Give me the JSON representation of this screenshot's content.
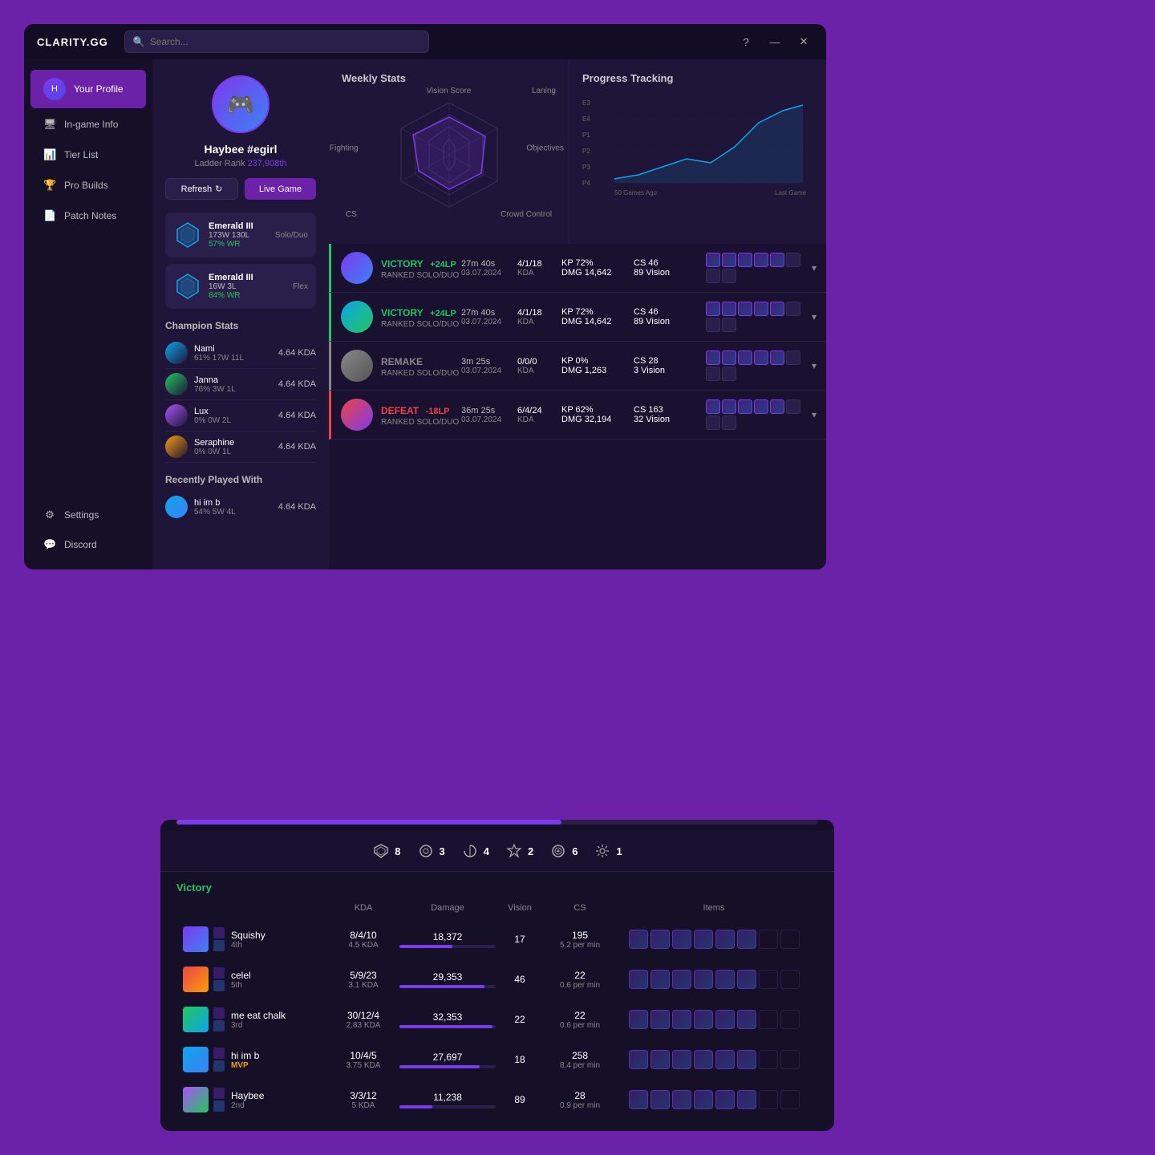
{
  "app": {
    "logo": "CLARITY.GG",
    "search_placeholder": "Search...",
    "search_label": "Search",
    "window_controls": {
      "help": "?",
      "minimize": "—",
      "close": "✕"
    }
  },
  "sidebar": {
    "items": [
      {
        "id": "profile",
        "label": "Your Profile",
        "icon": "👤",
        "active": true
      },
      {
        "id": "ingame",
        "label": "In-game Info",
        "icon": "🖥"
      },
      {
        "id": "tierlist",
        "label": "Tier List",
        "icon": "📊"
      },
      {
        "id": "probuilds",
        "label": "Pro Builds",
        "icon": "🏆"
      },
      {
        "id": "patchnotes",
        "label": "Patch Notes",
        "icon": "📄"
      }
    ],
    "bottom": [
      {
        "id": "settings",
        "label": "Settings",
        "icon": "⚙"
      },
      {
        "id": "discord",
        "label": "Discord",
        "icon": "💬"
      }
    ]
  },
  "profile": {
    "username": "Haybee #egirl",
    "ladder_rank_label": "Ladder Rank",
    "ladder_rank": "237,908th",
    "avatar_emoji": "🎮",
    "refresh_label": "Refresh",
    "live_game_label": "Live Game",
    "ranks": [
      {
        "name": "Emerald III",
        "mode": "Solo/Duo",
        "record": "173W 130L",
        "wr": "57% WR"
      },
      {
        "name": "Emerald III",
        "mode": "Flex",
        "record": "16W 3L",
        "wr": "84% WR"
      }
    ],
    "champion_stats_title": "Champion Stats",
    "champions": [
      {
        "name": "Nami",
        "sub": "61% 17W 11L",
        "kda": "4.64 KDA"
      },
      {
        "name": "Janna",
        "sub": "76% 3W 1L",
        "kda": "4.64 KDA"
      },
      {
        "name": "Lux",
        "sub": "0% 0W 2L",
        "kda": "4.64 KDA"
      },
      {
        "name": "Seraphine",
        "sub": "0% 0W 1L",
        "kda": "4.64 KDA"
      }
    ],
    "recently_played_title": "Recently Played With",
    "recent_players": [
      {
        "name": "hi im b",
        "sub": "54% 5W 4L",
        "kda": "4.64 KDA"
      }
    ]
  },
  "weekly_stats": {
    "title": "Weekly Stats",
    "labels": [
      "Vision Score",
      "Laning",
      "Objectives",
      "Crowd Control",
      "CS",
      "Fighting"
    ]
  },
  "progress_tracking": {
    "title": "Progress Tracking",
    "y_labels": [
      "E3",
      "E4",
      "P1",
      "P2",
      "P3",
      "P4"
    ],
    "x_labels": [
      "50 Games Ago",
      "Last Game"
    ]
  },
  "matches": [
    {
      "outcome": "VICTORY",
      "lp": "+24LP",
      "lp_sign": "positive",
      "mode": "RANKED SOLO/DUO",
      "duration": "27m 40s",
      "date": "03.07.2024",
      "kda": "4/1/18",
      "kda_label": "KDA",
      "kp": "KP 72%",
      "dmg": "DMG 14,642",
      "cs": "CS 46",
      "vision": "89 Vision",
      "type": "victory"
    },
    {
      "outcome": "VICTORY",
      "lp": "+24LP",
      "lp_sign": "positive",
      "mode": "RANKED SOLO/DUO",
      "duration": "27m 40s",
      "date": "03.07.2024",
      "kda": "4/1/18",
      "kda_label": "KDA",
      "kp": "KP 72%",
      "dmg": "DMG 14,642",
      "cs": "CS 46",
      "vision": "89 Vision",
      "type": "victory"
    },
    {
      "outcome": "REMAKE",
      "lp": "",
      "lp_sign": "neutral",
      "mode": "RANKED SOLO/DUO",
      "duration": "3m 25s",
      "date": "03.07.2024",
      "kda": "0/0/0",
      "kda_label": "KDA",
      "kp": "KP 0%",
      "dmg": "DMG 1,263",
      "cs": "CS 28",
      "vision": "3 Vision",
      "type": "remake"
    },
    {
      "outcome": "DEFEAT",
      "lp": "-18LP",
      "lp_sign": "negative",
      "mode": "RANKED SOLO/DUO",
      "duration": "36m 25s",
      "date": "03.07.2024",
      "kda": "6/4/24",
      "kda_label": "KDA",
      "kp": "KP 62%",
      "dmg": "DMG 32,194",
      "cs": "CS 163",
      "vision": "32 Vision",
      "type": "defeat"
    }
  ],
  "bottom_panel": {
    "header_stats": [
      {
        "icon": "🛡",
        "value": "8"
      },
      {
        "icon": "⊙",
        "value": "3"
      },
      {
        "icon": "❧",
        "value": "4"
      },
      {
        "icon": "🔰",
        "value": "2"
      },
      {
        "icon": "◎",
        "value": "6"
      },
      {
        "icon": "⚙",
        "value": "1"
      }
    ],
    "outcome_label": "Victory",
    "table_headers": [
      "KDA",
      "Damage",
      "Vision",
      "CS",
      "Items"
    ],
    "players": [
      {
        "name": "Squishy",
        "rank": "4th",
        "kda": "8/4/10",
        "kda_ratio": "4.5 KDA",
        "dmg": "18,372",
        "dmg_pct": 55,
        "vision": "17",
        "cs": "195",
        "cs_per": "5.2 per min",
        "mvp": false
      },
      {
        "name": "celel",
        "rank": "5th",
        "kda": "5/9/23",
        "kda_ratio": "3.1 KDA",
        "dmg": "29,353",
        "dmg_pct": 88,
        "vision": "46",
        "cs": "22",
        "cs_per": "0.6 per min",
        "mvp": false
      },
      {
        "name": "me eat chalk",
        "rank": "3rd",
        "kda": "30/12/4",
        "kda_ratio": "2.83 KDA",
        "dmg": "32,353",
        "dmg_pct": 97,
        "vision": "22",
        "cs": "22",
        "cs_per": "0.6 per min",
        "mvp": false
      },
      {
        "name": "hi im b",
        "rank": "MVP",
        "kda": "10/4/5",
        "kda_ratio": "3.75 KDA",
        "dmg": "27,697",
        "dmg_pct": 83,
        "vision": "18",
        "cs": "258",
        "cs_per": "8.4 per min",
        "mvp": true
      },
      {
        "name": "Haybee",
        "rank": "2nd",
        "kda": "3/3/12",
        "kda_ratio": "5 KDA",
        "dmg": "11,238",
        "dmg_pct": 34,
        "vision": "89",
        "cs": "28",
        "cs_per": "0.9 per min",
        "mvp": false
      }
    ]
  }
}
